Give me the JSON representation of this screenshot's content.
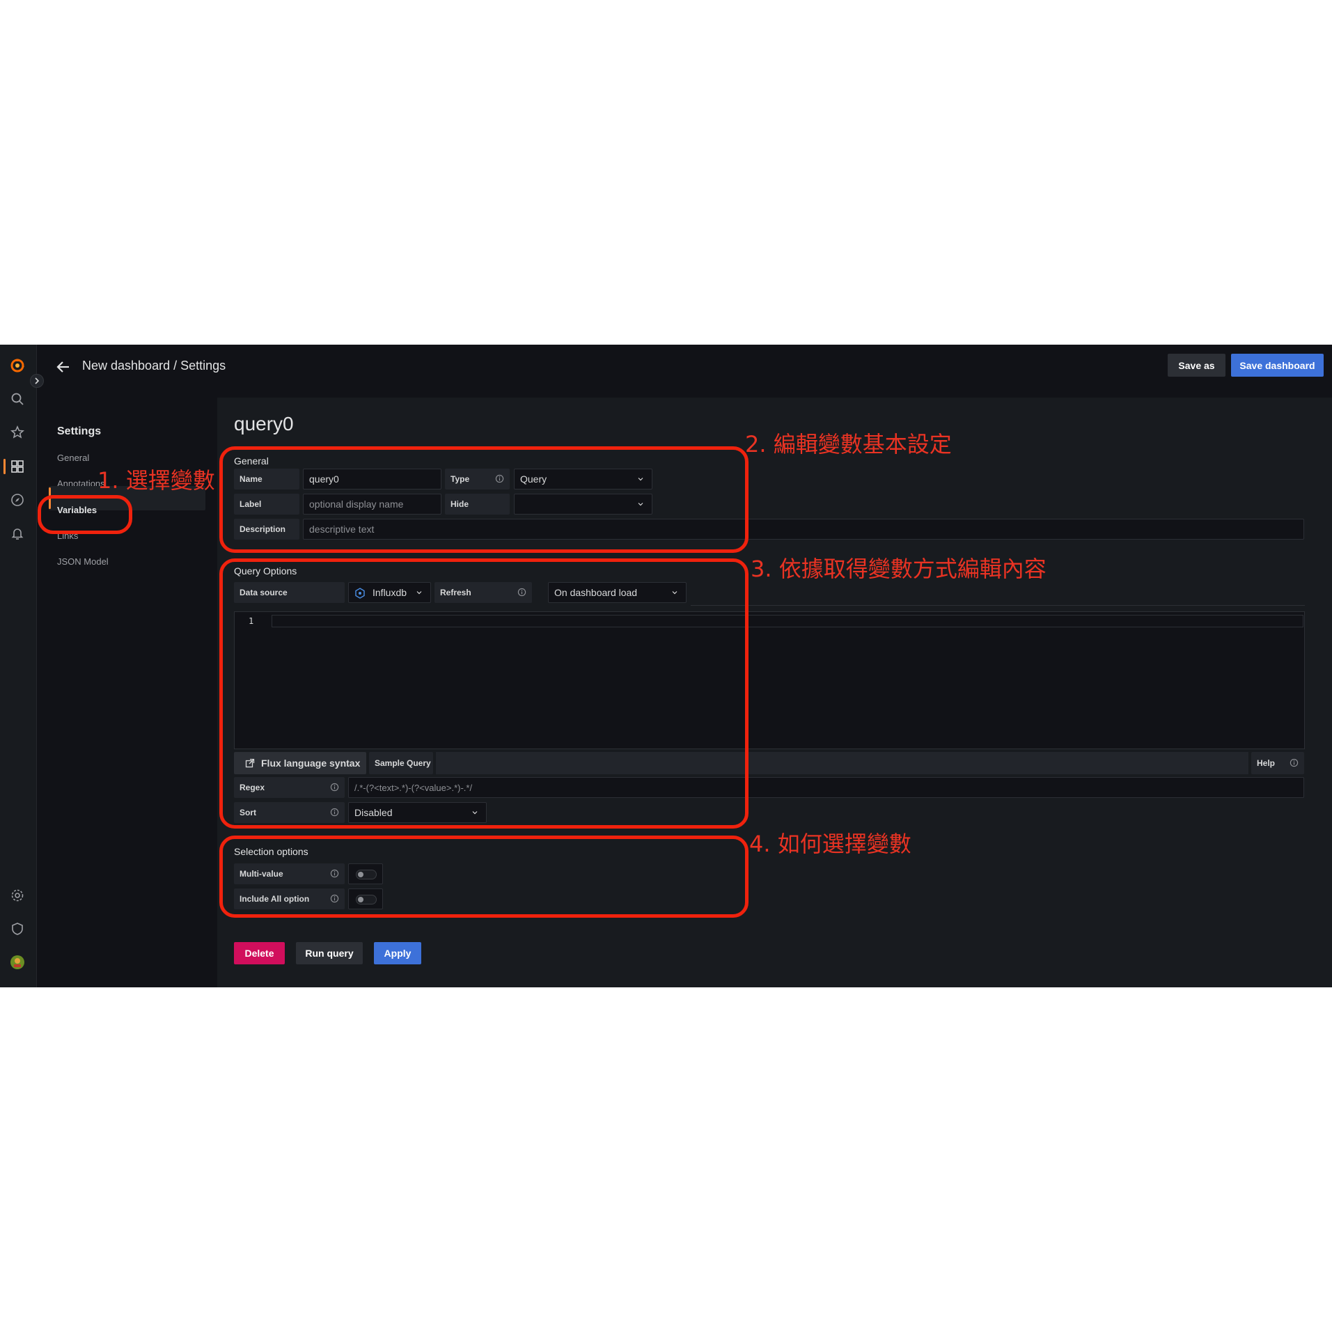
{
  "header": {
    "breadcrumb": "New dashboard / Settings",
    "save_as_label": "Save as",
    "save_dashboard_label": "Save dashboard"
  },
  "sidemenu": {
    "icons": [
      "grafana-logo-icon",
      "search-icon",
      "star-icon",
      "dashboards-icon",
      "explore-icon",
      "alerting-bell-icon",
      "gear-icon",
      "shield-icon",
      "avatar"
    ]
  },
  "settings_nav": {
    "title": "Settings",
    "items": [
      "General",
      "Annotations",
      "Variables",
      "Links",
      "JSON Model"
    ],
    "active": "Variables"
  },
  "variable": {
    "title": "query0",
    "general": {
      "section_title": "General",
      "name_label": "Name",
      "name_value": "query0",
      "type_label": "Type",
      "type_value": "Query",
      "label_label": "Label",
      "label_placeholder": "optional display name",
      "hide_label": "Hide",
      "hide_value": "",
      "description_label": "Description",
      "description_placeholder": "descriptive text"
    },
    "query_options": {
      "section_title": "Query Options",
      "data_source_label": "Data source",
      "data_source_value": "Influxdb",
      "refresh_label": "Refresh",
      "refresh_value": "On dashboard load",
      "editor_line_number": "1",
      "editor_value": "",
      "flux_syntax_label": "Flux language syntax",
      "sample_query_label": "Sample Query",
      "help_label": "Help",
      "regex_label": "Regex",
      "regex_placeholder": "/.*-(?<text>.*)-(?<value>.*)-.*/",
      "sort_label": "Sort",
      "sort_value": "Disabled"
    },
    "selection_options": {
      "section_title": "Selection options",
      "multi_value_label": "Multi-value",
      "multi_value": false,
      "include_all_label": "Include All option",
      "include_all": false
    },
    "actions": {
      "delete_label": "Delete",
      "run_query_label": "Run query",
      "apply_label": "Apply"
    }
  },
  "annotations": {
    "step1": "1. 選擇變數",
    "step2": "2. 編輯變數基本設定",
    "step3": "3. 依據取得變數方式編輯內容",
    "step4": "4. 如何選擇變數",
    "color": "#ea3323"
  },
  "colors": {
    "background": "#111217",
    "panel": "#181b1f",
    "accent_orange": "#ff8833",
    "primary_blue": "#3d71d9",
    "destructive_red": "#d10e5c"
  }
}
